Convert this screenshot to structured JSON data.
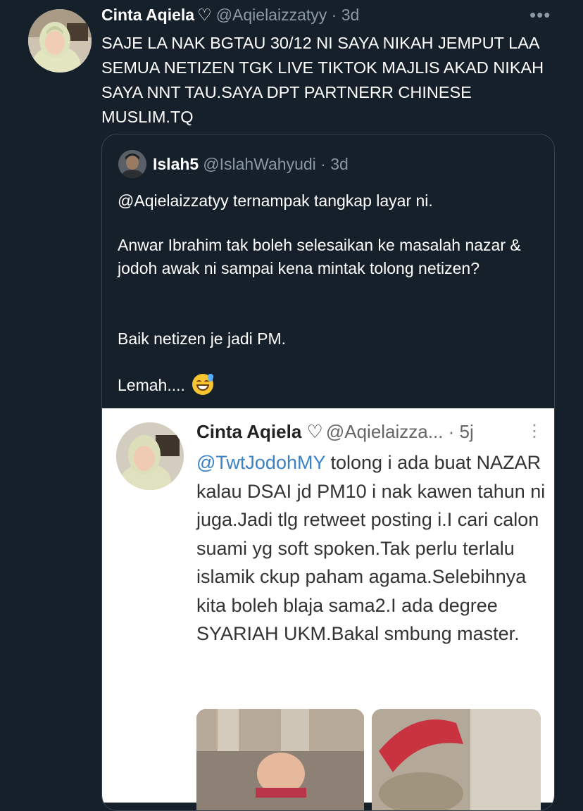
{
  "tweet": {
    "author_name": "Cinta Aqiela",
    "author_heart": "♡",
    "author_handle_time": "@Aqielaizzatyy · 3d",
    "more_label": "•••",
    "text": "SAJE LA NAK BGTAU 30/12 NI SAYA NIKAH JEMPUT LAA SEMUA NETIZEN TGK LIVE TIKTOK MAJLIS AKAD NIKAH SAYA NNT TAU.SAYA DPT PARTNERR CHINESE MUSLIM.TQ"
  },
  "quote": {
    "author_name": "Islah5",
    "author_handle_time": "@IslahWahyudi · 3d",
    "para1": "@Aqielaizzatyy ternampak tangkap layar ni.",
    "para2": "Anwar Ibrahim tak boleh selesaikan ke masalah nazar & jodoh awak ni sampai kena mintak tolong netizen?",
    "para3": "Baik netizen je jadi PM.",
    "para4": "Lemah....",
    "emoji": "grinning-face-with-sweat"
  },
  "screenshot": {
    "author_name": "Cinta Aqiela",
    "author_heart": "♡",
    "author_handle_time": "@Aqielaizza... · 5j",
    "more_label": "⋮",
    "mention": "@TwtJodohMY",
    "text_rest": " tolong i ada buat NAZAR kalau DSAI jd PM10 i nak kawen tahun ni juga.Jadi tlg retweet posting i.I cari calon suami yg soft spoken.Tak perlu terlalu islamik ckup paham agama.Selebihnya kita boleh blaja sama2.I ada degree SYARIAH UKM.Bakal smbung master."
  },
  "colors": {
    "background": "#15202b",
    "secondary_text": "#8b98a5",
    "border": "#38444d",
    "mention_blue": "#3b82c4"
  }
}
